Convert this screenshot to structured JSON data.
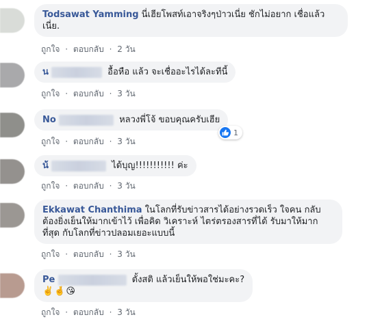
{
  "comments": [
    {
      "author": "Todsawat Yamming",
      "text": "นี่เฮียโพสท์เอาจริงๆป่าวเนี่ย ชักไม่อยาก เชื่อแล้วเนี่ย.",
      "like": "ถูกใจ",
      "reply": "ตอบกลับ",
      "time": "2 วัน"
    },
    {
      "author": "น",
      "text": "อื้อหือ แล้ว จะเชื่ออะไรได้ละทีนี้",
      "like": "ถูกใจ",
      "reply": "ตอบกลับ",
      "time": "3 วัน"
    },
    {
      "author": "No",
      "text": "หลวงพี่โจ้ ขอบคุณครับเฮีย",
      "like": "ถูกใจ",
      "reply": "ตอบกลับ",
      "time": "3 วัน",
      "reaction_count": "1"
    },
    {
      "author": "น้",
      "text": "ได้บุญ!!!!!!!!!!! ค่ะ",
      "like": "ถูกใจ",
      "reply": "ตอบกลับ",
      "time": "3 วัน"
    },
    {
      "author": "Ekkawat Chanthima",
      "text": "ในโลกที่รับข่าวสารได้อย่างรวดเร็ว ใจคน กลับต้องยิ่งเย็นให้มากเข้าไว้ เพื่อคิด วิเคราะห์ ไตร่ตรองสารที่ได้ รับมาให้มากที่สุด กับโลกที่ข่าวปลอมเยอะแบบนี้",
      "like": "ถูกใจ",
      "reply": "ตอบกลับ",
      "time": "3 วัน"
    },
    {
      "author": "Pe",
      "text": "ตั้งสติ แล้วเย็นให้พอใช่มะคะ?",
      "emojis": "✌️🤞😘",
      "like": "ถูกใจ",
      "reply": "ตอบกลับ",
      "time": "3 วัน"
    }
  ],
  "dot": "·",
  "colors": {
    "author": "#385898",
    "bubble": "#f2f3f5",
    "meta": "#606770",
    "like": "#1877f2"
  }
}
